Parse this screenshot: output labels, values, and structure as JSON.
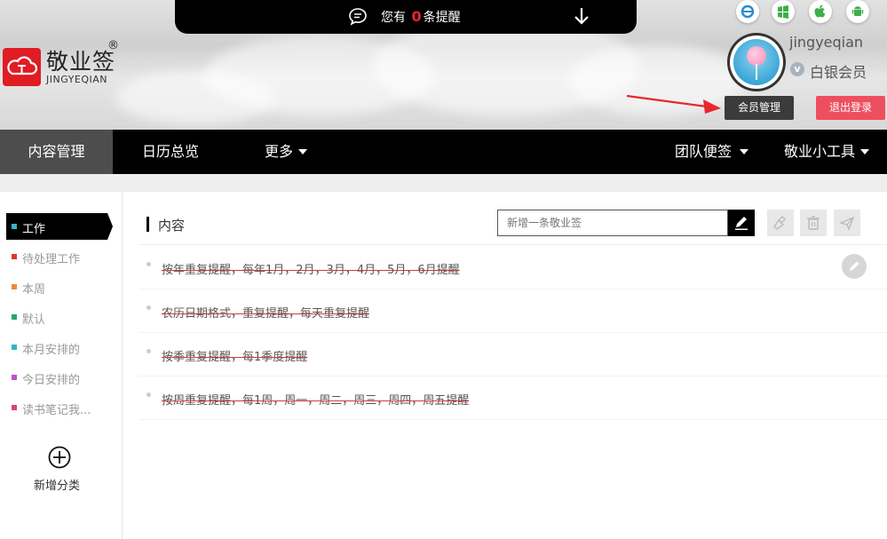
{
  "notice": {
    "prefix": "您有",
    "count": "0",
    "suffix": "条提醒"
  },
  "brand": {
    "name": "敬业签",
    "reg": "®",
    "sub": "JINGYEQIAN",
    "color": "#e01c24"
  },
  "platforms": [
    "ie-icon",
    "windows-icon",
    "apple-icon",
    "android-icon"
  ],
  "user": {
    "name": "jingyeqian",
    "badge": "v",
    "level": "白银会员"
  },
  "buttons": {
    "member": "会员管理",
    "logout": "退出登录"
  },
  "nav": {
    "items": [
      {
        "label": "内容管理"
      },
      {
        "label": "日历总览"
      },
      {
        "label": "更多"
      }
    ],
    "right": [
      {
        "label": "团队便签"
      },
      {
        "label": "敬业小工具"
      }
    ]
  },
  "categories": [
    {
      "label": "工作",
      "color": "#3ab3c4"
    },
    {
      "label": "待处理工作",
      "color": "#d8392b"
    },
    {
      "label": "本周",
      "color": "#f08a3b"
    },
    {
      "label": "默认",
      "color": "#20a96b"
    },
    {
      "label": "本月安排的",
      "color": "#2fb6c8"
    },
    {
      "label": "今日安排的",
      "color": "#b858c4"
    },
    {
      "label": "读书笔记我...",
      "color": "#d8476a"
    }
  ],
  "add_category": "新增分类",
  "content": {
    "title": "内容",
    "placeholder": "新增一条敬业签",
    "items": [
      "按年重复提醒，每年1月，2月，3月，4月，5月，6月提醒",
      "农历日期格式，重复提醒，每天重复提醒",
      "按季重复提醒，每1季度提醒",
      "按周重复提醒，每1周，周一，周二，周三，周四，周五提醒"
    ]
  }
}
